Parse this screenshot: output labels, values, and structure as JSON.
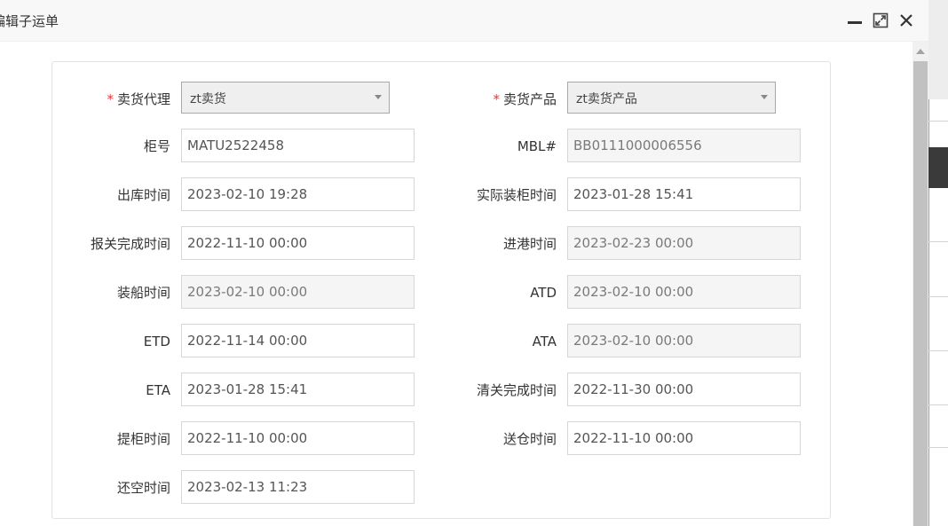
{
  "dialog": {
    "title": "编辑子运单"
  },
  "form": {
    "seller_agent": {
      "label": "卖货代理",
      "required_mark": "*",
      "value": "zt卖货"
    },
    "seller_product": {
      "label": "卖货产品",
      "required_mark": "*",
      "value": "zt卖货产品"
    },
    "container_no": {
      "label": "柜号",
      "value": "MATU2522458"
    },
    "mbl": {
      "label": "MBL#",
      "value": "BB0111000006556"
    },
    "outbound_time": {
      "label": "出库时间",
      "value": "2023-02-10 19:28"
    },
    "actual_loading_time": {
      "label": "实际装柜时间",
      "value": "2023-01-28 15:41"
    },
    "customs_done_time": {
      "label": "报关完成时间",
      "value": "2022-11-10 00:00"
    },
    "port_entry_time": {
      "label": "进港时间",
      "value": "2023-02-23 00:00"
    },
    "shipping_time": {
      "label": "装船时间",
      "value": "2023-02-10 00:00"
    },
    "atd": {
      "label": "ATD",
      "value": "2023-02-10 00:00"
    },
    "etd": {
      "label": "ETD",
      "value": "2022-11-14 00:00"
    },
    "ata": {
      "label": "ATA",
      "value": "2023-02-10 00:00"
    },
    "eta": {
      "label": "ETA",
      "value": "2023-01-28 15:41"
    },
    "clearance_done_time": {
      "label": "清关完成时间",
      "value": "2022-11-30 00:00"
    },
    "pickup_time": {
      "label": "提柜时间",
      "value": "2022-11-10 00:00"
    },
    "warehouse_delivery_time": {
      "label": "送仓时间",
      "value": "2022-11-10 00:00"
    },
    "empty_return_time": {
      "label": "还空时间",
      "value": "2023-02-13 11:23"
    }
  },
  "icons": {
    "minimize": "minimize-icon",
    "maximize": "maximize-icon",
    "close": "close-icon",
    "dropdown": "chevron-down-icon"
  },
  "colors": {
    "required": "#e4393c",
    "header_bg": "#f8f8f8",
    "readonly_bg": "#f5f5f5"
  }
}
